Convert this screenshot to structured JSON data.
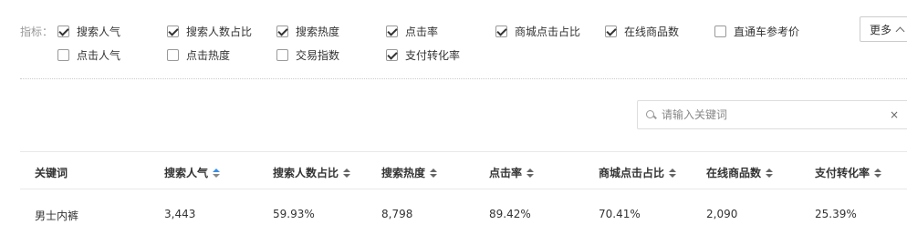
{
  "indicators": {
    "label": "指标：",
    "options": [
      {
        "label": "搜索人气",
        "checked": true
      },
      {
        "label": "搜索人数占比",
        "checked": true
      },
      {
        "label": "搜索热度",
        "checked": true
      },
      {
        "label": "点击率",
        "checked": true
      },
      {
        "label": "商城点击占比",
        "checked": true
      },
      {
        "label": "在线商品数",
        "checked": true
      },
      {
        "label": "直通车参考价",
        "checked": false
      },
      {
        "label": "点击人气",
        "checked": false
      },
      {
        "label": "点击热度",
        "checked": false
      },
      {
        "label": "交易指数",
        "checked": false
      },
      {
        "label": "支付转化率",
        "checked": true
      }
    ],
    "more_label": "更多"
  },
  "search": {
    "placeholder": "请输入关键词",
    "clear_label": "×"
  },
  "table": {
    "columns": [
      "关键词",
      "搜索人气",
      "搜索人数占比",
      "搜索热度",
      "点击率",
      "商城点击占比",
      "在线商品数",
      "支付转化率"
    ],
    "rows": [
      [
        "男士内裤",
        "3,443",
        "59.93%",
        "8,798",
        "89.42%",
        "70.41%",
        "2,090",
        "25.39%"
      ]
    ]
  },
  "colors": {
    "active_sort": "#3a8ee6",
    "border": "#e8e8e8"
  }
}
